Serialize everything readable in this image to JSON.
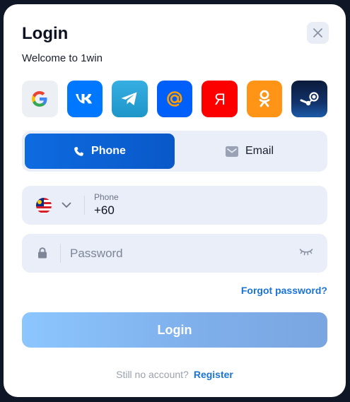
{
  "modal": {
    "title": "Login",
    "welcome": "Welcome to 1win",
    "close_icon": "close-icon"
  },
  "social": [
    {
      "name": "google",
      "icon": "google-icon",
      "letter": "G"
    },
    {
      "name": "vk",
      "icon": "vk-icon",
      "letter": "VK"
    },
    {
      "name": "telegram",
      "icon": "telegram-icon"
    },
    {
      "name": "mail-ru",
      "icon": "at-icon",
      "letter": "@"
    },
    {
      "name": "yandex",
      "icon": "yandex-icon",
      "letter": "Я"
    },
    {
      "name": "odnoklassniki",
      "icon": "ok-icon"
    },
    {
      "name": "steam",
      "icon": "steam-icon"
    }
  ],
  "tabs": {
    "phone_label": "Phone",
    "email_label": "Email",
    "active": "phone"
  },
  "phone": {
    "label": "Phone",
    "value": "+60",
    "country_flag": "malaysia-flag-icon"
  },
  "password": {
    "placeholder": "Password"
  },
  "forgot_label": "Forgot password?",
  "login_label": "Login",
  "footer": {
    "prompt": "Still no account?",
    "register_label": "Register"
  },
  "colors": {
    "accent": "#0d6be0",
    "link": "#1a73d6",
    "field_bg": "#eaeef8",
    "backdrop": "#0f1626"
  }
}
